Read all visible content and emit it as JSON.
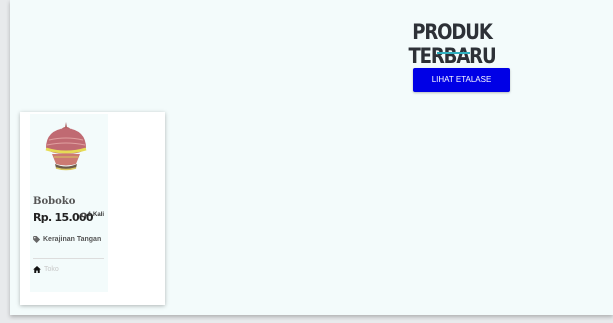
{
  "section": {
    "title": "PRODUK TERBARU",
    "button_label": "LIHAT ETALASE",
    "accent_color": "#2fb0bf",
    "button_color": "#0000e6"
  },
  "product": {
    "name": "Boboko",
    "price": "Rp. 15.000",
    "views": "1 Kali",
    "views_icon": "eye-icon",
    "category": "Kerajinan Tangan",
    "category_icon": "tag-icon",
    "footer_text": "Toko",
    "footer_icon": "home-icon",
    "image_icon": "woven-basket-icon"
  }
}
